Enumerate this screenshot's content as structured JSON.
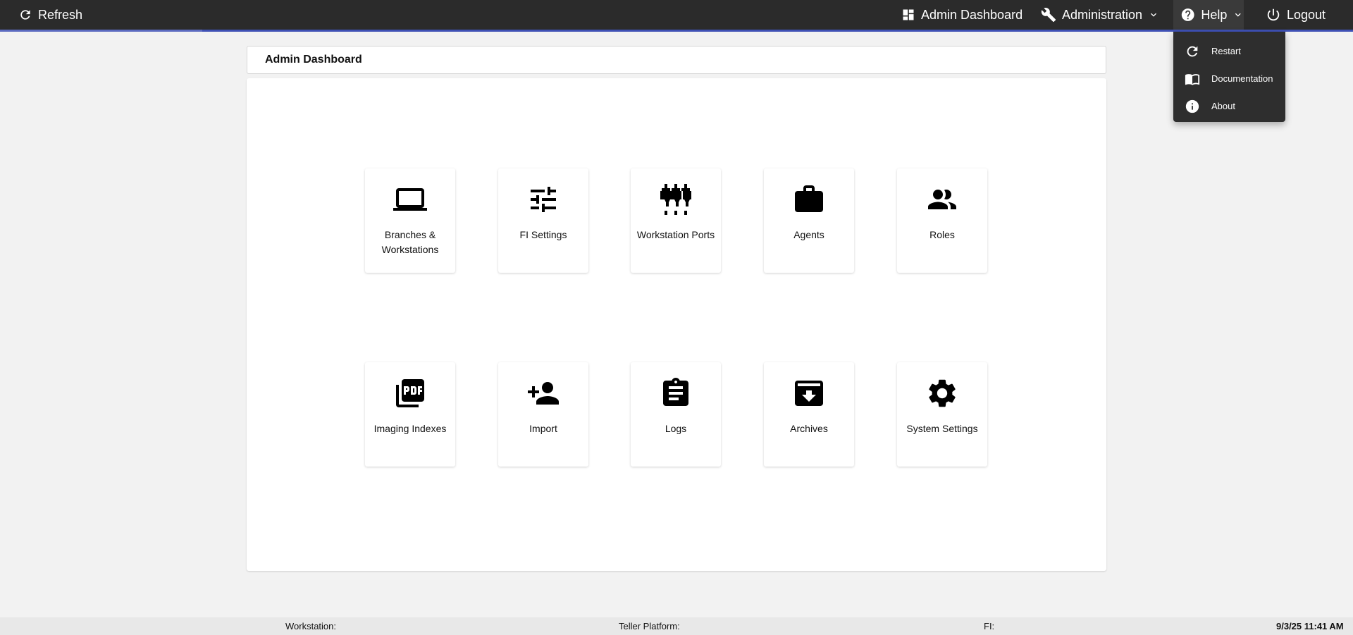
{
  "topbar": {
    "refresh_label": "Refresh",
    "admin_dashboard_label": "Admin Dashboard",
    "administration_label": "Administration",
    "help_label": "Help",
    "logout_label": "Logout",
    "accent_color": "#3f51b5"
  },
  "help_menu": {
    "items": [
      {
        "label": "Restart",
        "icon": "restart-icon"
      },
      {
        "label": "Documentation",
        "icon": "book-icon"
      },
      {
        "label": "About",
        "icon": "info-icon"
      }
    ]
  },
  "page": {
    "title": "Admin Dashboard"
  },
  "tiles": [
    {
      "label": "Branches & Workstations",
      "icon": "laptop-icon"
    },
    {
      "label": "FI Settings",
      "icon": "sliders-icon"
    },
    {
      "label": "Workstation Ports",
      "icon": "ports-icon"
    },
    {
      "label": "Agents",
      "icon": "briefcase-icon"
    },
    {
      "label": "Roles",
      "icon": "people-icon"
    },
    {
      "label": "Imaging Indexes",
      "icon": "pdf-icon"
    },
    {
      "label": "Import",
      "icon": "person-add-icon"
    },
    {
      "label": "Logs",
      "icon": "clipboard-icon"
    },
    {
      "label": "Archives",
      "icon": "archive-icon"
    },
    {
      "label": "System Settings",
      "icon": "gear-icon"
    }
  ],
  "footer": {
    "workstation_label": "Workstation:",
    "teller_platform_label": "Teller Platform:",
    "fi_label": "FI:",
    "datetime": "9/3/25 11:41 AM"
  }
}
